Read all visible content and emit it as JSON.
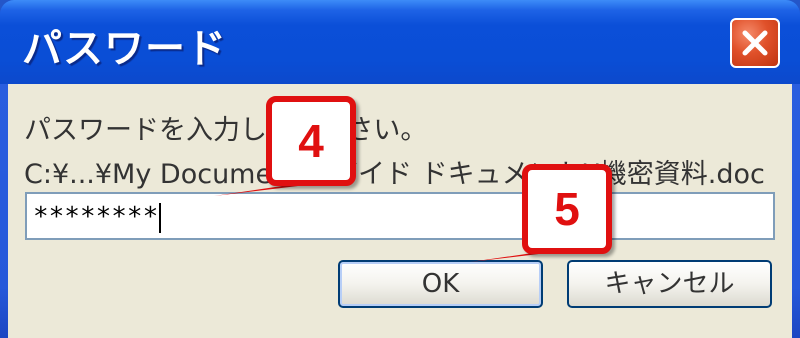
{
  "window": {
    "title": "パスワード",
    "close_icon": "close-icon"
  },
  "dialog": {
    "prompt": "パスワードを入力してください。",
    "file_path": "C:¥...¥My Documents¥ガイド ドキュメント¥機密資料.doc",
    "password_value": "********"
  },
  "buttons": {
    "ok_label": "OK",
    "cancel_label": "キャンセル"
  },
  "annotations": {
    "callout_4": "4",
    "callout_5": "5",
    "callout_color": "#e01010"
  }
}
